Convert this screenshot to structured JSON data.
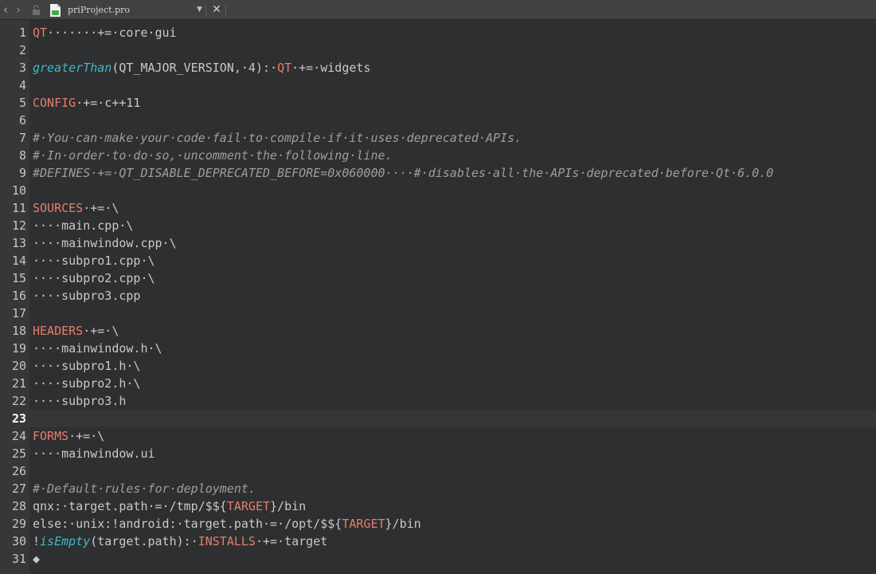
{
  "toolbar": {
    "back_icon": "‹",
    "forward_icon": "›",
    "lock_icon": "lock-icon",
    "file_icon": "qt-project-file-icon",
    "filename": "priProject.pro",
    "dropdown_icon": "▼",
    "close_icon": "✕"
  },
  "colors": {
    "keyword": "#e57e6d",
    "function": "#40b8c8",
    "comment": "#9e9e9e",
    "text": "#c9c9c9",
    "background": "#2e2f30",
    "gutter": "#363738"
  },
  "editor": {
    "current_line": 23,
    "line_numbers": [
      1,
      2,
      3,
      4,
      5,
      6,
      7,
      8,
      9,
      10,
      11,
      12,
      13,
      14,
      15,
      16,
      17,
      18,
      19,
      20,
      21,
      22,
      23,
      24,
      25,
      26,
      27,
      28,
      29,
      30,
      31
    ],
    "lines": [
      [
        {
          "t": "QT",
          "c": "kw"
        },
        {
          "t": "·······+=·core·gui",
          "c": "tx"
        }
      ],
      [],
      [
        {
          "t": "greaterThan",
          "c": "fn"
        },
        {
          "t": "(QT_MAJOR_VERSION,·4):·",
          "c": "tx"
        },
        {
          "t": "QT",
          "c": "kw"
        },
        {
          "t": "·+=·widgets",
          "c": "tx"
        }
      ],
      [],
      [
        {
          "t": "CONFIG",
          "c": "kw"
        },
        {
          "t": "·+=·c++11",
          "c": "tx"
        }
      ],
      [],
      [
        {
          "t": "#·You·can·make·your·code·fail·to·compile·if·it·uses·deprecated·APIs.",
          "c": "cm"
        }
      ],
      [
        {
          "t": "#·In·order·to·do·so,·uncomment·the·following·line.",
          "c": "cm"
        }
      ],
      [
        {
          "t": "#DEFINES·+=·QT_DISABLE_DEPRECATED_BEFORE=0x060000····#·disables·all·the·APIs·deprecated·before·Qt·6.0.0",
          "c": "cm"
        }
      ],
      [],
      [
        {
          "t": "SOURCES",
          "c": "kw"
        },
        {
          "t": "·+=·\\",
          "c": "tx"
        }
      ],
      [
        {
          "t": "····main.cpp·\\",
          "c": "tx"
        }
      ],
      [
        {
          "t": "····mainwindow.cpp·\\",
          "c": "tx"
        }
      ],
      [
        {
          "t": "····subpro1.cpp·\\",
          "c": "tx"
        }
      ],
      [
        {
          "t": "····subpro2.cpp·\\",
          "c": "tx"
        }
      ],
      [
        {
          "t": "····subpro3.cpp",
          "c": "tx"
        }
      ],
      [],
      [
        {
          "t": "HEADERS",
          "c": "kw"
        },
        {
          "t": "·+=·\\",
          "c": "tx"
        }
      ],
      [
        {
          "t": "····mainwindow.h·\\",
          "c": "tx"
        }
      ],
      [
        {
          "t": "····subpro1.h·\\",
          "c": "tx"
        }
      ],
      [
        {
          "t": "····subpro2.h·\\",
          "c": "tx"
        }
      ],
      [
        {
          "t": "····subpro3.h",
          "c": "tx"
        }
      ],
      [],
      [
        {
          "t": "FORMS",
          "c": "kw"
        },
        {
          "t": "·+=·\\",
          "c": "tx"
        }
      ],
      [
        {
          "t": "····mainwindow.ui",
          "c": "tx"
        }
      ],
      [],
      [
        {
          "t": "#·Default·rules·for·deployment.",
          "c": "cm"
        }
      ],
      [
        {
          "t": "qnx:·target.path·=·/tmp/$${",
          "c": "tx"
        },
        {
          "t": "TARGET",
          "c": "kw"
        },
        {
          "t": "}/bin",
          "c": "tx"
        }
      ],
      [
        {
          "t": "else:·unix:!android:·target.path·=·/opt/$${",
          "c": "tx"
        },
        {
          "t": "TARGET",
          "c": "kw"
        },
        {
          "t": "}/bin",
          "c": "tx"
        }
      ],
      [
        {
          "t": "!",
          "c": "tx"
        },
        {
          "t": "isEmpty",
          "c": "fn"
        },
        {
          "t": "(target.path):·",
          "c": "tx"
        },
        {
          "t": "INSTALLS",
          "c": "kw"
        },
        {
          "t": "·+=·target",
          "c": "tx"
        }
      ],
      [
        {
          "t": "◆",
          "c": "tx"
        }
      ]
    ]
  }
}
